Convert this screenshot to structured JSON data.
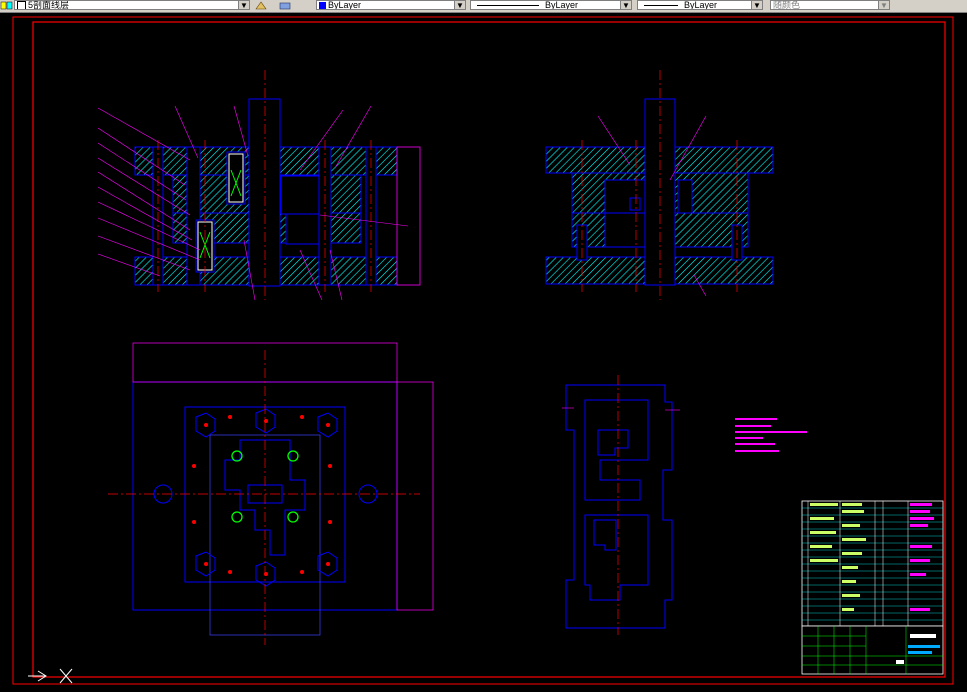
{
  "toolbar": {
    "layer_name": "5剖面线层",
    "color": "ByLayer",
    "linetype": "ByLayer",
    "lineweight": "ByLayer",
    "plotstyle": "随颜色",
    "colors": {
      "layer_yellow": "#ffff00",
      "layer_cyan": "#00ffff",
      "color_swatch": "#0000ff",
      "bg": "#d4d0c8"
    }
  },
  "drawing": {
    "colors": {
      "frame": "#ff0000",
      "outline": "#0000ff",
      "hatch": "#00ffff",
      "centerline": "#ff0000",
      "leader": "#ff00ff",
      "white": "#ffffff",
      "green": "#00ff00",
      "yellow_green": "#ccff66",
      "magenta": "#ff00ff"
    },
    "icons": [
      "ucs-icon",
      "layer-icon",
      "sun-icon"
    ]
  }
}
